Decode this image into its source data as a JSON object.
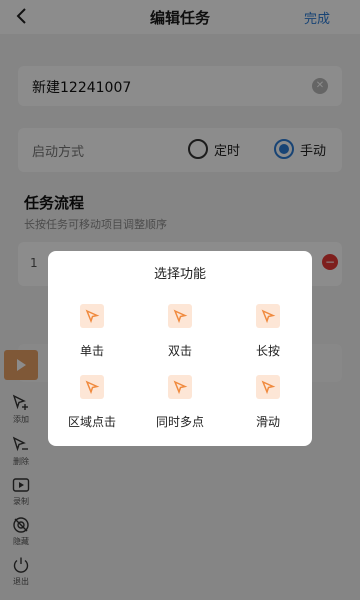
{
  "header": {
    "title": "编辑任务",
    "done_label": "完成",
    "back_icon": "chevron-left-icon"
  },
  "task": {
    "name": "新建12241007"
  },
  "start_mode": {
    "label": "启动方式",
    "options": [
      {
        "label": "定时",
        "selected": false
      },
      {
        "label": "手动",
        "selected": true
      }
    ]
  },
  "flow": {
    "title": "任务流程",
    "hint": "长按任务可移动项目调整顺序",
    "first_step_number": "1"
  },
  "toolbar": {
    "items": [
      {
        "label": "添加",
        "icon": "cursor-plus-icon"
      },
      {
        "label": "删除",
        "icon": "cursor-minus-icon"
      },
      {
        "label": "录制",
        "icon": "record-icon"
      },
      {
        "label": "隐藏",
        "icon": "eye-off-icon"
      },
      {
        "label": "退出",
        "icon": "power-icon"
      }
    ]
  },
  "dialog": {
    "title": "选择功能",
    "functions": [
      {
        "label": "单击",
        "icon": "cursor-tap-icon"
      },
      {
        "label": "双击",
        "icon": "cursor-double-tap-icon"
      },
      {
        "label": "长按",
        "icon": "cursor-long-press-icon"
      },
      {
        "label": "区域点击",
        "icon": "cursor-area-icon"
      },
      {
        "label": "同时多点",
        "icon": "cursor-multi-icon"
      },
      {
        "label": "滑动",
        "icon": "cursor-swipe-icon"
      }
    ]
  },
  "colors": {
    "accent": "#2d7cd6",
    "function_icon_bg": "#fde6d6",
    "function_icon": "#f08a3e",
    "play_button": "#e8a064",
    "delete": "#e53935"
  }
}
